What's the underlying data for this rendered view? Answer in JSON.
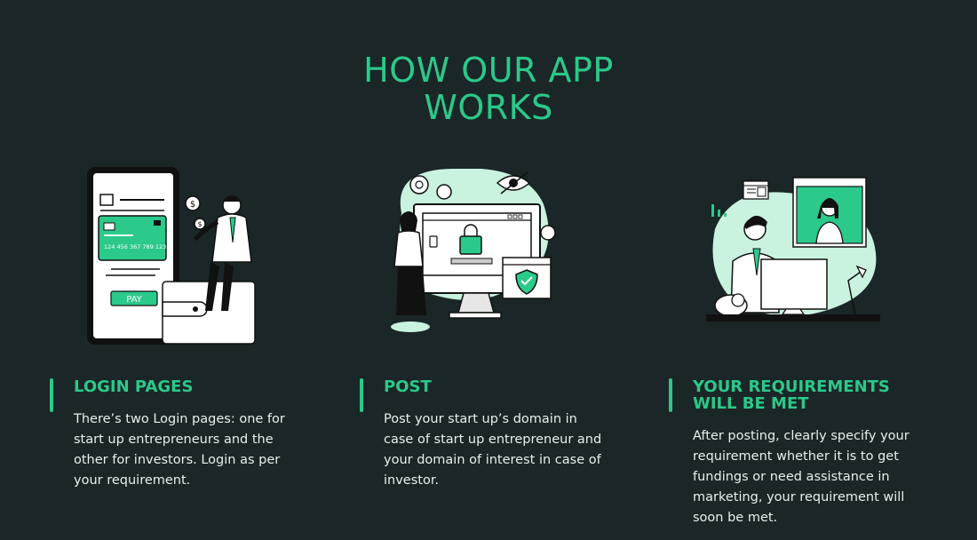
{
  "section": {
    "title_line1": "HOW OUR APP",
    "title_line2": "WORKS"
  },
  "colors": {
    "background": "#1a2627",
    "accent": "#2bc98a",
    "mint": "#c9f2df",
    "text": "#e9efee"
  },
  "steps": [
    {
      "illustration": "phone-payment-illustration",
      "pay_label": "PAY",
      "card_number": "124 456 367 789 123",
      "heading": "LOGIN PAGES",
      "body": "There’s two Login pages: one for start up entrepreneurs and the other for investors. Login as per your requirement."
    },
    {
      "illustration": "secure-monitor-illustration",
      "heading": "POST",
      "body": "Post your start up’s domain in case of start up entrepreneur and your domain of interest in case of investor."
    },
    {
      "illustration": "video-call-illustration",
      "heading_line1": "YOUR REQUIREMENTS",
      "heading_line2": "WILL BE MET",
      "body": "After posting, clearly specify your requirement whether it is to get fundings or need assistance in marketing, your requirement will soon be met."
    }
  ]
}
